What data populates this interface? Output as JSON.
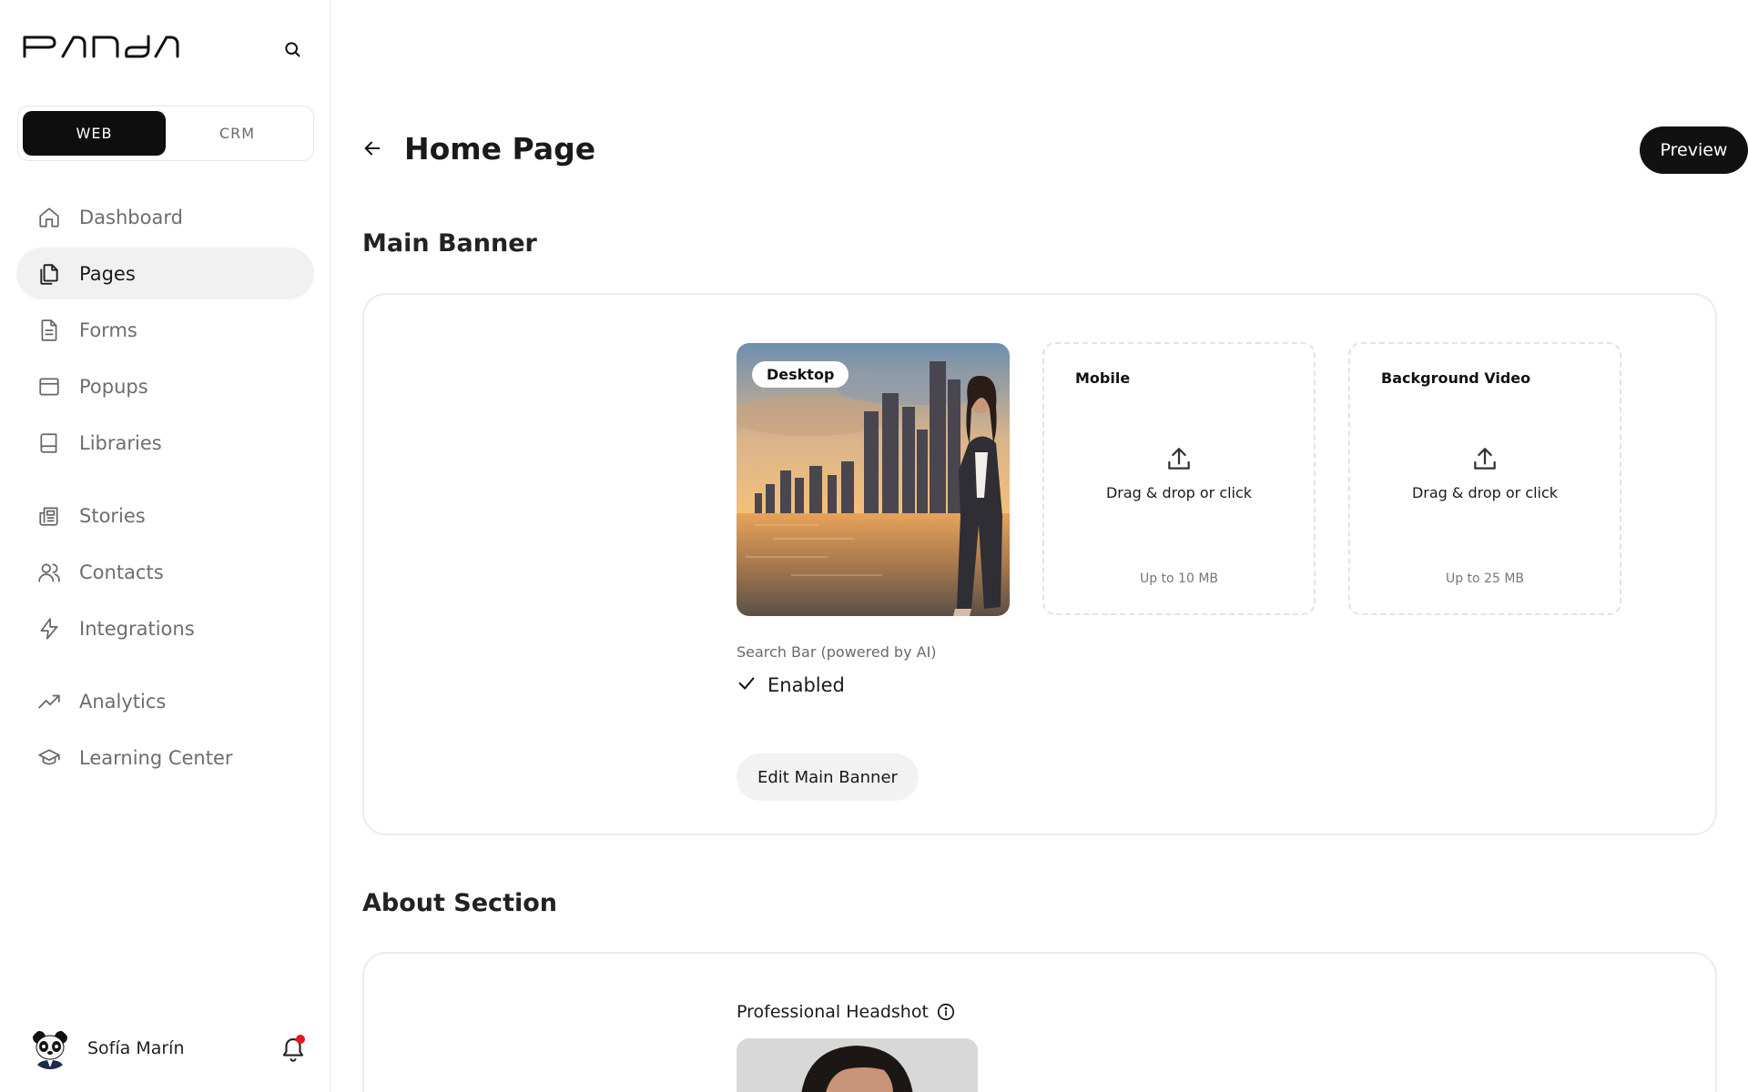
{
  "brand": {
    "logo_text": "PANDA",
    "search_icon": "search-icon"
  },
  "mode_toggle": {
    "options": [
      "WEB",
      "CRM"
    ],
    "selected": "WEB"
  },
  "sidebar": {
    "items": [
      {
        "label": "Dashboard",
        "icon": "home-icon"
      },
      {
        "label": "Pages",
        "icon": "pages-icon",
        "active": true
      },
      {
        "label": "Forms",
        "icon": "document-icon"
      },
      {
        "label": "Popups",
        "icon": "window-icon"
      },
      {
        "label": "Libraries",
        "icon": "book-icon"
      },
      {
        "label": "Stories",
        "icon": "newspaper-icon"
      },
      {
        "label": "Contacts",
        "icon": "users-icon"
      },
      {
        "label": "Integrations",
        "icon": "lightning-icon"
      },
      {
        "label": "Analytics",
        "icon": "trend-up-icon"
      },
      {
        "label": "Learning Center",
        "icon": "graduation-cap-icon"
      }
    ]
  },
  "user": {
    "name": "Sofía Marín",
    "has_notification": true
  },
  "header": {
    "title": "Home Page",
    "preview_label": "Preview"
  },
  "main_banner": {
    "section_title": "Main Banner",
    "desktop_badge": "Desktop",
    "mobile": {
      "label": "Mobile",
      "upload_text": "Drag & drop or click",
      "limit": "Up to 10 MB"
    },
    "video": {
      "label": "Background Video",
      "upload_text": "Drag & drop or click",
      "limit": "Up to 25 MB"
    },
    "search_bar_label": "Search Bar (powered by AI)",
    "search_bar_status": "Enabled",
    "edit_label": "Edit Main Banner"
  },
  "about": {
    "section_title": "About Section",
    "headshot_label": "Professional Headshot"
  },
  "colors": {
    "accent": "#111111",
    "notification": "#e3191f",
    "active_bg": "#f1f1f1"
  }
}
